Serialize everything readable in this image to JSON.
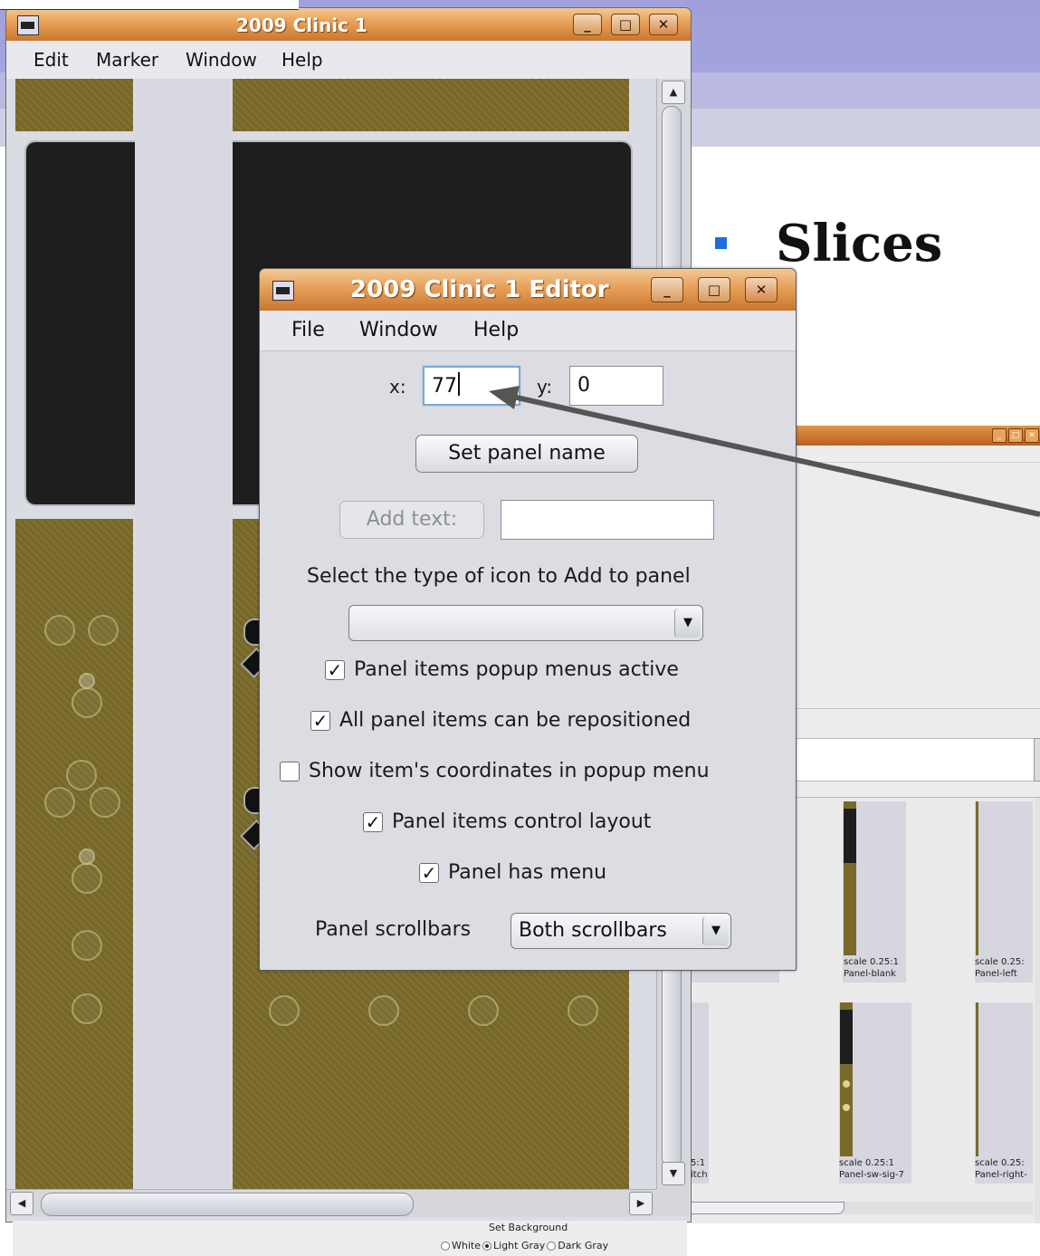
{
  "slide": {
    "heading": "Slices"
  },
  "main_window": {
    "title": "2009 Clinic 1",
    "menu": [
      "Edit",
      "Marker",
      "Window",
      "Help"
    ],
    "controls": {
      "minimize": "_",
      "maximize": "□",
      "close": "✕"
    }
  },
  "catalog": {
    "thumbnails": [
      {
        "scale": "scale 0.25:1",
        "name": "Panel-blank"
      },
      {
        "scale": "scale 0.25:",
        "name": "Panel-left"
      },
      {
        "scale": "5:1",
        "name": "itch"
      },
      {
        "scale": "scale 0.25:1",
        "name": "Panel-sw-sig-7"
      },
      {
        "scale": "scale 0.25:",
        "name": "Panel-right-"
      }
    ],
    "background": {
      "label": "Set Background",
      "options": [
        "White",
        "Light Gray",
        "Dark Gray"
      ],
      "selected": "Light Gray"
    }
  },
  "editor": {
    "title": "2009 Clinic 1 Editor",
    "menu": [
      "File",
      "Window",
      "Help"
    ],
    "x_label": "x:",
    "x_value": "77",
    "y_label": "y:",
    "y_value": "0",
    "set_panel_name": "Set panel name",
    "add_text": "Add text:",
    "add_text_value": "",
    "icon_type_label": "Select the type of icon to Add to panel",
    "icon_type_value": "",
    "checkboxes": [
      {
        "label": "Panel items popup menus active",
        "checked": true
      },
      {
        "label": "All panel items can be repositioned",
        "checked": true
      },
      {
        "label": "Show item's coordinates in popup menu",
        "checked": false
      },
      {
        "label": "Panel items control layout",
        "checked": true
      },
      {
        "label": "Panel has menu",
        "checked": true
      }
    ],
    "scrollbars_label": "Panel scrollbars",
    "scrollbars_value": "Both scrollbars"
  },
  "colors": {
    "title_bar": "#e9a25a",
    "panel_olive": "#7a6a2a",
    "bullet": "#1c6fe0",
    "annotation_arrow": "#555555"
  }
}
